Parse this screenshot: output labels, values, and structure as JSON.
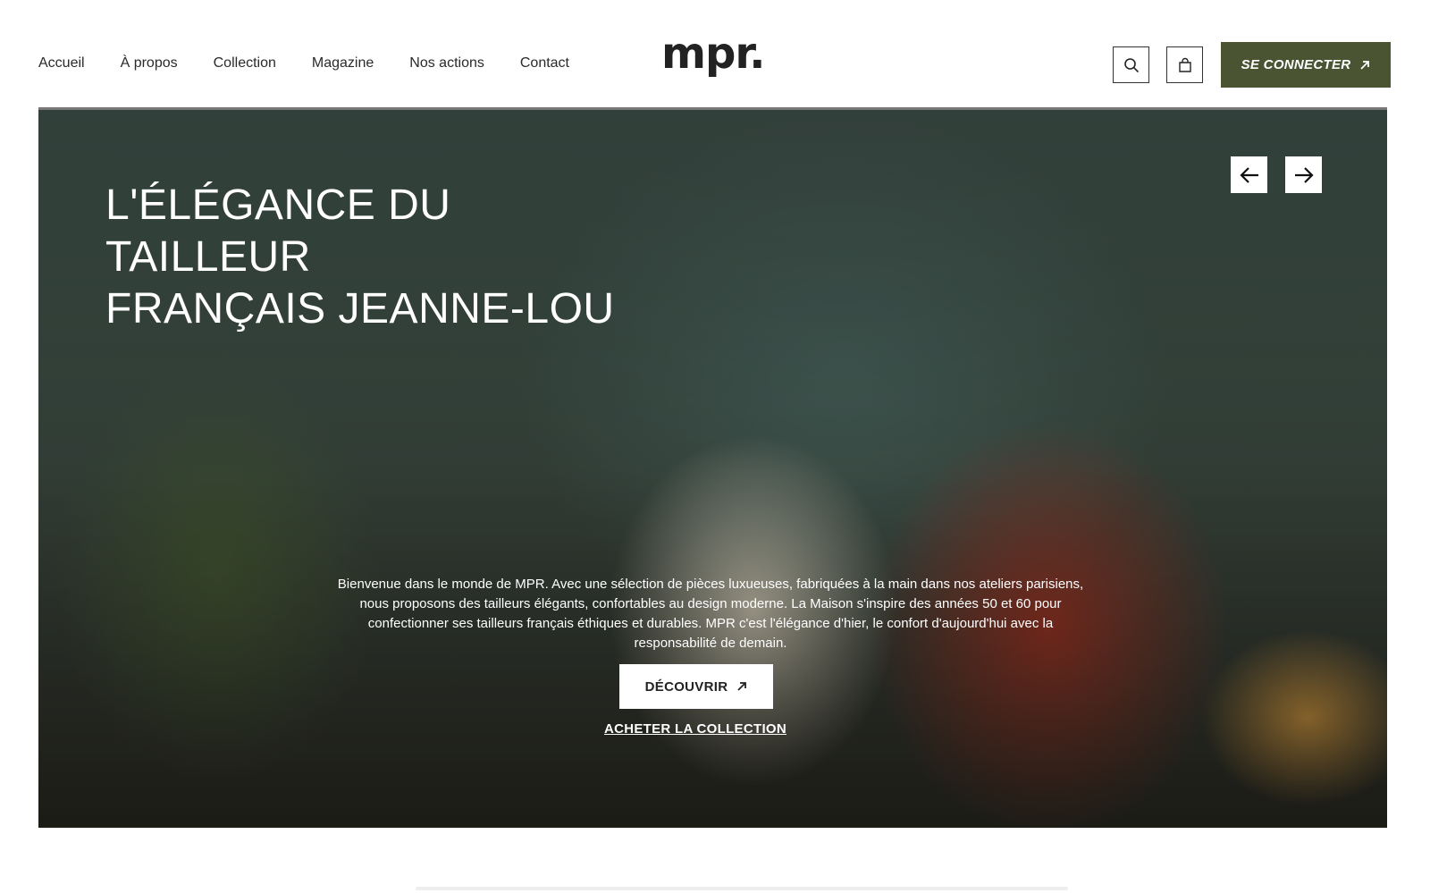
{
  "header": {
    "nav": [
      "Accueil",
      "À propos",
      "Collection",
      "Magazine",
      "Nos actions",
      "Contact"
    ],
    "logo": "mpr.",
    "search_icon": "search-icon",
    "cart_icon": "shopping-bag-icon",
    "connect_label": "SE CONNECTER",
    "connect_icon": "arrow-up-right-icon",
    "accent_color": "#4a5332"
  },
  "hero": {
    "title_line1": "L'ÉLÉGANCE DU TAILLEUR",
    "title_line2": "FRANÇAIS JEANNE-LOU",
    "prev_icon": "arrow-left-icon",
    "next_icon": "arrow-right-icon",
    "description": "Bienvenue dans le monde de MPR. Avec une sélection de pièces luxueuses, fabriquées à la main dans nos ateliers parisiens, nous proposons des tailleurs élégants, confortables au design moderne. La Maison s'inspire des années 50 et 60 pour confectionner ses tailleurs français éthiques et durables. MPR c'est l'élégance d'hier, le confort d'aujourd'hui avec la responsabilité de demain.",
    "discover_label": "DÉCOUVRIR",
    "shop_label": "ACHETER LA COLLECTION"
  }
}
